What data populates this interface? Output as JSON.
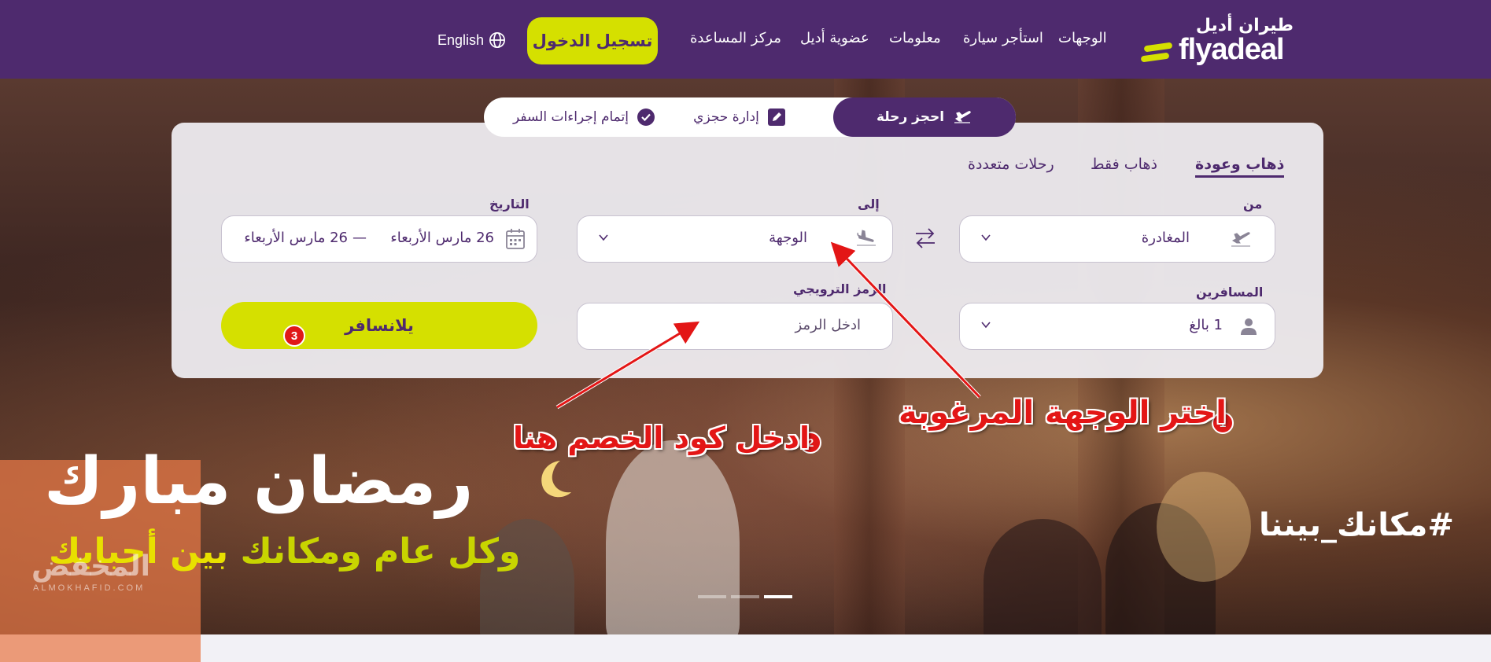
{
  "header": {
    "logo_ar": "طيران أديل",
    "logo_en": "flyadeal",
    "nav": [
      "الوجهات",
      "استأجر سيارة",
      "معلومات",
      "عضوية أديل",
      "مركز المساعدة"
    ],
    "login_label": "تسجيل الدخول",
    "language_label": "English"
  },
  "tabs": {
    "book": "احجز رحلة",
    "manage": "إدارة حجزي",
    "checkin": "إتمام إجراءات السفر"
  },
  "trip_types": {
    "round_trip": "ذهاب وعودة",
    "one_way": "ذهاب فقط",
    "multi_city": "رحلات متعددة"
  },
  "form": {
    "from_label": "من",
    "from_value": "المغادرة",
    "to_label": "إلى",
    "to_value": "الوجهة",
    "date_label": "التاريخ",
    "date_start": "26 مارس الأربعاء",
    "date_separator": "—",
    "date_end": "26 مارس الأربعاء",
    "passengers_label": "المسافرين",
    "passengers_value": "1 بالغ",
    "promo_label": "الرمز الترويجي",
    "promo_value": "ادخل الرمز",
    "search_label": "يلانسافر"
  },
  "annotations": {
    "step1_number": "1",
    "step1_text": "اختر الوجهة المرغوبة",
    "step2_number": "2",
    "step2_text": "ادخل كود الخصم هنا",
    "step3_number": "3"
  },
  "banner": {
    "title": "رمضان مبارك",
    "greeting_white": "وكل عام ومكانك",
    "greeting_yellow": "بين أحبابك",
    "hashtag": "#مكانك_بيننا"
  },
  "watermark": {
    "text": "المخفض",
    "sub": "ALMOKHAFID.COM"
  },
  "colors": {
    "brand_purple": "#4e2a6e",
    "brand_yellow": "#d5e000",
    "annotation_red": "#e31616"
  },
  "icons": [
    "globe-icon",
    "plane-takeoff-icon",
    "edit-icon",
    "check-circle-icon",
    "swap-icon",
    "plane-landing-icon",
    "calendar-icon",
    "user-icon",
    "chevron-down-icon"
  ]
}
